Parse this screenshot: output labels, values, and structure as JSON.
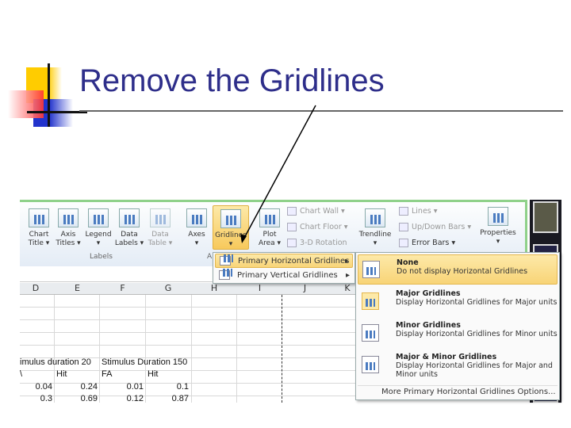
{
  "slide": {
    "title": "Remove the Gridlines"
  },
  "ribbon": {
    "buttons": [
      {
        "label1": "Chart",
        "label2": "Title ▾"
      },
      {
        "label1": "Axis",
        "label2": "Titles ▾"
      },
      {
        "label1": "Legend",
        "label2": "▾"
      },
      {
        "label1": "Data",
        "label2": "Labels ▾"
      },
      {
        "label1": "Data",
        "label2": "Table ▾"
      },
      {
        "label1": "Axes",
        "label2": "▾"
      },
      {
        "label1": "Gridlines",
        "label2": "▾"
      },
      {
        "label1": "Plot",
        "label2": "Area ▾"
      },
      {
        "label1": "Trendline",
        "label2": "▾"
      },
      {
        "label1": "Properties",
        "label2": "▾"
      }
    ],
    "small_buttons": [
      "Chart Wall ▾",
      "Chart Floor ▾",
      "3-D Rotation",
      "Lines ▾",
      "Up/Down Bars ▾",
      "Error Bars ▾"
    ],
    "groups": {
      "labels": "Labels",
      "axes": "A"
    }
  },
  "sheet": {
    "columns": [
      "D",
      "E",
      "F",
      "G",
      "H",
      "I",
      "J",
      "K"
    ],
    "header_row": [
      "imulus duration 20",
      "Stimulus Duration 150"
    ],
    "sub_header": [
      "\\",
      "Hit",
      "FA",
      "Hit"
    ],
    "rows": [
      [
        "0.04",
        "0.24",
        "0.01",
        "0.1"
      ],
      [
        "0.3",
        "0.69",
        "0.12",
        "0.87"
      ]
    ]
  },
  "gridlines_menu": {
    "items": [
      "Primary Horizontal Gridlines",
      "Primary Vertical Gridlines"
    ]
  },
  "horizontal_menu": {
    "items": [
      {
        "title": "None",
        "desc": "Do not display Horizontal Gridlines"
      },
      {
        "title": "Major Gridlines",
        "desc": "Display Horizontal Gridlines for Major units"
      },
      {
        "title": "Minor Gridlines",
        "desc": "Display Horizontal Gridlines for Minor units"
      },
      {
        "title": "Major & Minor Gridlines",
        "desc": "Display Horizontal Gridlines for Major and Minor units"
      }
    ],
    "more": "More Primary Horizontal Gridlines Options..."
  },
  "colors": {
    "title": "#2e2e8a",
    "highlight": "#f8d477",
    "ribbon_border": "#8fd18a"
  }
}
